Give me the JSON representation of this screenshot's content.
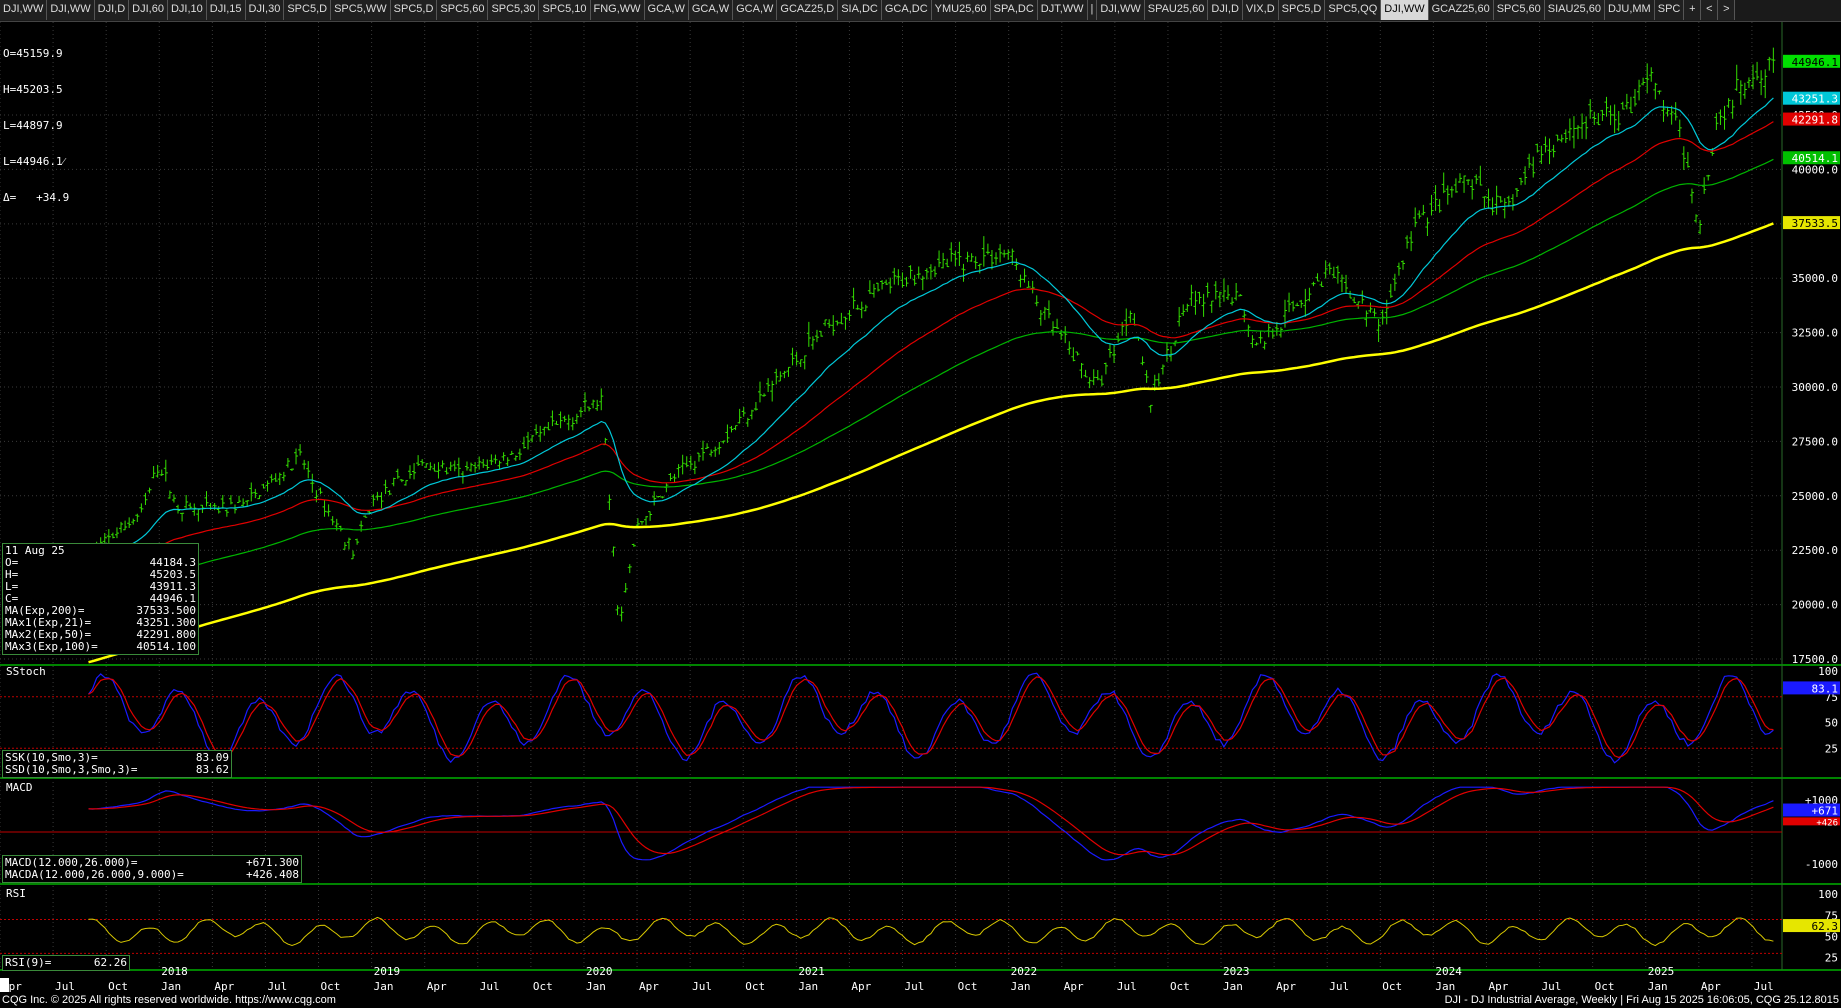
{
  "tabs": [
    "DJI,WW",
    "DJI,WW",
    "DJI,D",
    "DJI,60",
    "DJI,10",
    "DJI,15",
    "DJI,30",
    "SPC5,D",
    "SPC5,WW",
    "SPC5,D",
    "SPC5,60",
    "SPC5,30",
    "SPC5,10",
    "FNG,WW",
    "GCA,W",
    "GCA,W",
    "GCA,W",
    "GCAZ25,D",
    "SIA,DC",
    "GCA,DC",
    "YMU25,60",
    "SPA,DC",
    "DJT,WW",
    "|",
    "DJI,WW",
    "SPAU25,60",
    "DJI,D",
    "VIX,D",
    "SPC5,D",
    "SPC5,QQ",
    "DJI,WW",
    "GCAZ25,60",
    "SPC5,60",
    "SIAU25,60",
    "DJU,MM",
    "SPC",
    "+",
    "<",
    ">"
  ],
  "active_tab_index": 30,
  "quote_box": {
    "o": "O=45159.9",
    "h": "H=45203.5",
    "l1": "L=44897.9",
    "l2": "L=44946.1⁄",
    "d": "Δ=   +34.9"
  },
  "ohlc_box": {
    "date": "11 Aug 25",
    "rows": [
      {
        "k": "O=",
        "v": "44184.3"
      },
      {
        "k": "H=",
        "v": "45203.5"
      },
      {
        "k": "L=",
        "v": "43911.3"
      },
      {
        "k": "C=",
        "v": "44946.1"
      },
      {
        "k": "MA(Exp,200)=",
        "v": "37533.500"
      },
      {
        "k": "MAx1(Exp,21)=",
        "v": "43251.300"
      },
      {
        "k": "MAx2(Exp,50)=",
        "v": "42291.800"
      },
      {
        "k": "MAx3(Exp,100)=",
        "v": "40514.100"
      }
    ]
  },
  "stoch_box": {
    "title": "SStoch",
    "k_label": "SSK(10,Smo,3)=",
    "k_val": "83.09",
    "d_label": "SSD(10,Smo,3,Smo,3)=",
    "d_val": "83.62"
  },
  "macd_box": {
    "title": "MACD",
    "m_label": "MACD(12.000,26.000)=",
    "m_val": "+671.300",
    "a_label": "MACDA(12.000,26.000,9.000)=",
    "a_val": "+426.408"
  },
  "rsi_box": {
    "title": "RSI",
    "label": "RSI(9)=",
    "val": "62.26"
  },
  "footer": {
    "left": "CQG Inc. © 2025 All rights reserved worldwide. https://www.cqg.com",
    "right": "DJI - DJ Industrial Average, Weekly | Fri Aug 15 2025 16:06:05, CQG 25.12.8015"
  },
  "colors": {
    "bars": "#33dd00",
    "ma200": "#ffff00",
    "ma21": "#00c8d8",
    "ma50": "#e00000",
    "ma100": "#00b400",
    "stoch_k": "#1a1aff",
    "stoch_d": "#e00000",
    "rsi": "#d8c800",
    "grid": "#3a3a3a",
    "axis_text": "#ffffff"
  },
  "chart_data": [
    {
      "type": "ohlc",
      "title": "DJI - DJ Industrial Average, Weekly",
      "x_start": "2017-09",
      "x_end": "2025-08",
      "ylim": [
        17500,
        46500
      ],
      "y_ticks": [
        17500,
        20000,
        22500,
        25000,
        27500,
        30000,
        32500,
        35000,
        37500,
        40000,
        42500
      ],
      "y_tick_labels": [
        "17500.0",
        "20000.0",
        "22500.0",
        "25000.0",
        "27500.0",
        "30000.0",
        "32500.0",
        "35000.0",
        "37500.0",
        "40000.0",
        "42500.0"
      ],
      "close_series": {
        "name": "DJI",
        "dates": [
          "2017-09",
          "2017-12",
          "2018-01",
          "2018-02",
          "2018-04",
          "2018-06",
          "2018-09",
          "2018-10",
          "2018-12",
          "2019-01",
          "2019-04",
          "2019-06",
          "2019-09",
          "2019-12",
          "2020-02",
          "2020-03",
          "2020-04",
          "2020-06",
          "2020-09",
          "2020-12",
          "2021-03",
          "2021-06",
          "2021-08",
          "2021-11",
          "2022-01",
          "2022-03",
          "2022-06",
          "2022-08",
          "2022-09",
          "2022-11",
          "2023-02",
          "2023-03",
          "2023-07",
          "2023-10",
          "2023-12",
          "2024-03",
          "2024-05",
          "2024-07",
          "2024-09",
          "2024-12",
          "2025-01",
          "2025-03",
          "2025-04",
          "2025-05",
          "2025-07",
          "2025-08"
        ],
        "values": [
          22300,
          24200,
          26500,
          24500,
          24300,
          24700,
          26800,
          25000,
          22400,
          24700,
          26500,
          26000,
          26900,
          28500,
          29400,
          19000,
          23500,
          25800,
          27800,
          30400,
          33000,
          34500,
          35400,
          35900,
          36200,
          33300,
          30000,
          33800,
          29300,
          33800,
          34200,
          31900,
          35300,
          32900,
          37500,
          39500,
          38000,
          40800,
          42000,
          42700,
          44500,
          41500,
          37600,
          42200,
          44500,
          44946.1
        ]
      },
      "last_labels": [
        {
          "name": "close",
          "value": "44946.1",
          "color": "#00e000"
        },
        {
          "name": "MAx1(Exp,21)",
          "value": "43251.3",
          "color": "#00c8d8"
        },
        {
          "name": "MAx2(Exp,50)",
          "value": "42291.8",
          "color": "#e00000"
        },
        {
          "name": "MAx3(Exp,100)",
          "value": "40514.1",
          "color": "#00c000"
        },
        {
          "name": "MA(Exp,200)",
          "value": "37533.5",
          "color": "#e6e600"
        }
      ]
    },
    {
      "type": "line",
      "title": "SStoch",
      "ylim": [
        0,
        100
      ],
      "y_ticks": [
        25,
        50,
        75,
        100
      ],
      "y_tick_labels": [
        "25",
        "50",
        "75",
        "100"
      ],
      "series": [
        {
          "name": "SSK",
          "last": "83.1"
        }
      ],
      "reference_lines": [
        75,
        25
      ]
    },
    {
      "type": "line",
      "title": "MACD",
      "ylim": [
        -1500,
        1500
      ],
      "y_ticks": [
        -1000,
        1000
      ],
      "y_tick_labels": [
        "-1000",
        "+1000"
      ],
      "series": [
        {
          "name": "MACD",
          "last": "+671"
        },
        {
          "name": "MACDA",
          "last": "+426"
        }
      ],
      "reference_lines": [
        0
      ]
    },
    {
      "type": "line",
      "title": "RSI",
      "ylim": [
        15,
        105
      ],
      "y_ticks": [
        25,
        50,
        75,
        100
      ],
      "y_tick_labels": [
        "25",
        "50",
        "75",
        "100"
      ],
      "series": [
        {
          "name": "RSI",
          "last": "62.3"
        }
      ],
      "reference_lines": [
        70,
        30
      ]
    }
  ],
  "x_axis": {
    "months": [
      "Apr",
      "Jul",
      "Oct",
      "Jan",
      "Apr",
      "Jul",
      "Oct",
      "Jan",
      "Apr",
      "Jul",
      "Oct",
      "Jan",
      "Apr",
      "Jul",
      "Oct",
      "Jan",
      "Apr",
      "Jul",
      "Oct",
      "Jan",
      "Apr",
      "Jul",
      "Oct",
      "Jan",
      "Apr",
      "Jul",
      "Oct",
      "Jan",
      "Apr",
      "Jul",
      "Oct",
      "Jan",
      "Apr",
      "Jul"
    ],
    "month_dates": [
      "2017-04",
      "2017-07",
      "2017-10",
      "2018-01",
      "2018-04",
      "2018-07",
      "2018-10",
      "2019-01",
      "2019-04",
      "2019-07",
      "2019-10",
      "2020-01",
      "2020-04",
      "2020-07",
      "2020-10",
      "2021-01",
      "2021-04",
      "2021-07",
      "2021-10",
      "2022-01",
      "2022-04",
      "2022-07",
      "2022-10",
      "2023-01",
      "2023-04",
      "2023-07",
      "2023-10",
      "2024-01",
      "2024-04",
      "2024-07",
      "2024-10",
      "2025-01",
      "2025-04",
      "2025-07"
    ],
    "years": [
      "2018",
      "2019",
      "2020",
      "2021",
      "2022",
      "2023",
      "2024",
      "2025"
    ],
    "year_dates": [
      "2018-01",
      "2019-01",
      "2020-01",
      "2021-01",
      "2022-01",
      "2023-01",
      "2024-01",
      "2025-01"
    ]
  }
}
